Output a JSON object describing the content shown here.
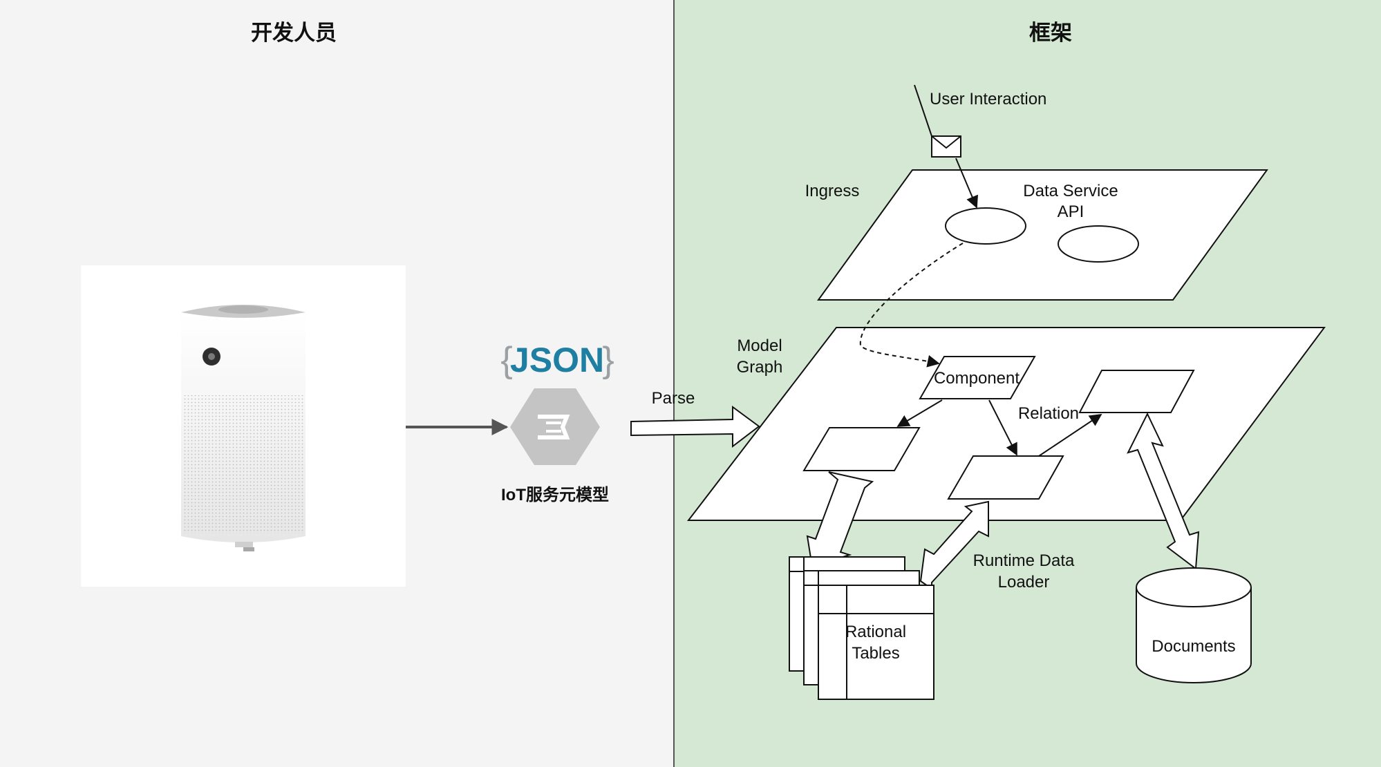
{
  "panels": {
    "left_title": "开发人员",
    "right_title": "框架"
  },
  "colors": {
    "left_bg": "#f4f4f4",
    "right_bg": "#d5e8d4",
    "json_blue": "#1e7fa3",
    "json_brace": "#9aa0a4",
    "hex_gray": "#c4c4c4"
  },
  "icons": {
    "device": "air-purifier-image",
    "json_logo": "json-logo",
    "model": "hexagon-document-icon",
    "message": "envelope-icon",
    "store": "database-cylinder-icon"
  },
  "json_logo": {
    "open": "{",
    "word": "JSON",
    "close": "}"
  },
  "model_label": "IoT服务元模型",
  "labels": {
    "parse": "Parse",
    "user_interaction": "User Interaction",
    "ingress": "Ingress",
    "data_service_1": "Data Service",
    "data_service_2": "API",
    "model_graph_1": "Model",
    "model_graph_2": "Graph",
    "component": "Component",
    "relation": "Relation",
    "runtime_1": "Runtime Data",
    "runtime_2": "Loader",
    "tables_1": "Rational",
    "tables_2": "Tables",
    "documents": "Documents"
  }
}
